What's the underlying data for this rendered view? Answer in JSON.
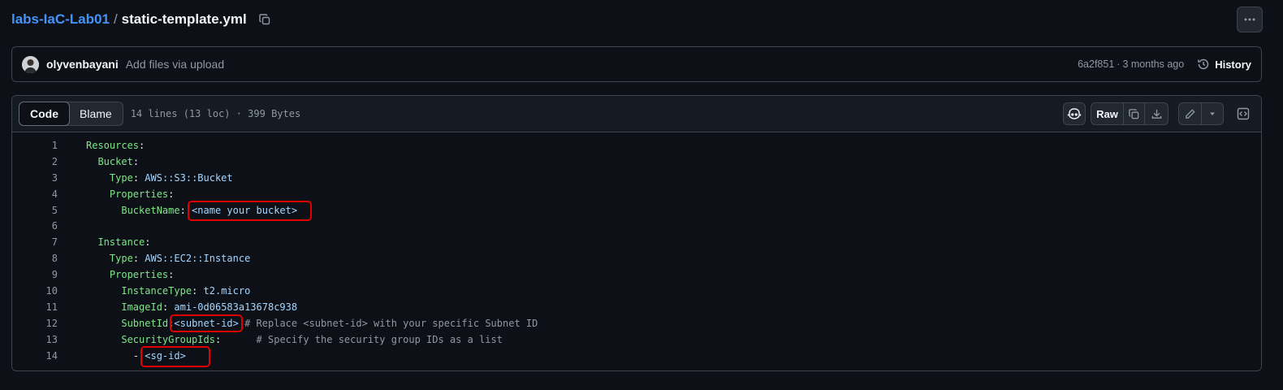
{
  "breadcrumb": {
    "repo": "labs-IaC-Lab01",
    "separator": "/",
    "file": "static-template.yml",
    "copy_icon": "copy-icon",
    "more_icon": "kebab-horizontal-icon"
  },
  "commit": {
    "author": "olyvenbayani",
    "message": "Add files via upload",
    "sha": "6a2f851",
    "dot": "·",
    "ago": "3 months ago",
    "history_label": "History",
    "history_icon": "history-icon"
  },
  "file_header": {
    "tab_code": "Code",
    "tab_blame": "Blame",
    "info": "14 lines (13 loc) · 399 Bytes",
    "raw_label": "Raw",
    "copilot_icon": "copilot-icon",
    "copy_icon": "copy-icon",
    "download_icon": "download-icon",
    "edit_icon": "pencil-icon",
    "dropdown_icon": "triangle-down-icon",
    "symbols_icon": "code-square-icon"
  },
  "code_lines": [
    {
      "n": "1",
      "key": "Resources",
      "indent": "",
      "after": ":"
    },
    {
      "n": "2",
      "key": "Bucket",
      "indent": "  ",
      "after": ":"
    },
    {
      "n": "3",
      "key": "Type",
      "indent": "    ",
      "after": ": ",
      "value": "AWS::S3::Bucket"
    },
    {
      "n": "4",
      "key": "Properties",
      "indent": "    ",
      "after": ":"
    },
    {
      "n": "5",
      "key": "BucketName",
      "indent": "      ",
      "after": ": ",
      "value": "<name your bucket>"
    },
    {
      "n": "6"
    },
    {
      "n": "7",
      "key": "Instance",
      "indent": "  ",
      "after": ":"
    },
    {
      "n": "8",
      "key": "Type",
      "indent": "    ",
      "after": ": ",
      "value": "AWS::EC2::Instance"
    },
    {
      "n": "9",
      "key": "Properties",
      "indent": "    ",
      "after": ":"
    },
    {
      "n": "10",
      "key": "InstanceType",
      "indent": "      ",
      "after": ": ",
      "value": "t2.micro"
    },
    {
      "n": "11",
      "key": "ImageId",
      "indent": "      ",
      "after": ": ",
      "value": "ami-0d06583a13678c938"
    },
    {
      "n": "12",
      "key": "SubnetId",
      "indent": "      ",
      "after": ":",
      "value": "<subnet-id>",
      "comment": "# Replace <subnet-id> with your specific Subnet ID"
    },
    {
      "n": "13",
      "key": "SecurityGroupIds",
      "indent": "      ",
      "after": ":",
      "comment": "# Specify the security group IDs as a list"
    },
    {
      "n": "14",
      "dash": "- ",
      "indent": "        ",
      "value": "<sg-id>"
    }
  ],
  "colors": {
    "background": "#0d1117",
    "link": "#4493f8",
    "yaml_key": "#7ee787",
    "yaml_string": "#a5d6ff",
    "annotation_box": "#e00000"
  }
}
